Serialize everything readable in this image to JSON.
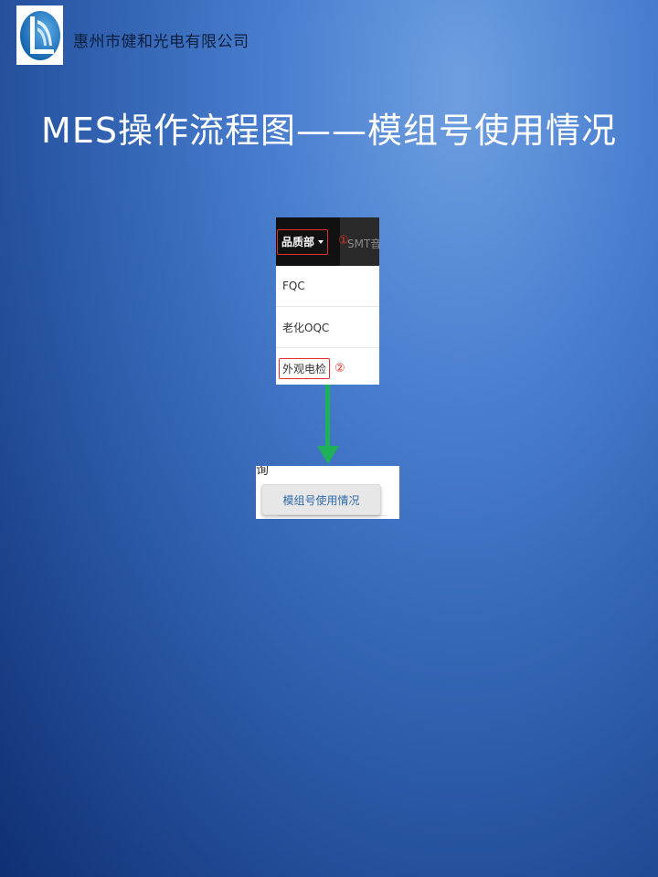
{
  "header": {
    "company_name": "惠州市健和光电有限公司"
  },
  "slide": {
    "title": "MES操作流程图——模组号使用情况"
  },
  "menu_screenshot": {
    "department_button": "品质部",
    "step1_marker": "①",
    "nav_next_item": "SMT音",
    "items": [
      {
        "label": "FQC"
      },
      {
        "label": "老化OQC"
      },
      {
        "label": "外观电检"
      }
    ],
    "step2_marker": "②"
  },
  "button_screenshot": {
    "fragment_text": "询",
    "button_label": "模组号使用情况"
  },
  "colors": {
    "highlight": "#e23030",
    "arrow": "#1fb05a",
    "link_text": "#2f6aa8"
  },
  "icons": {
    "logo": "company-logo-icon",
    "caret": "caret-down-icon",
    "arrow": "arrow-down-icon"
  }
}
